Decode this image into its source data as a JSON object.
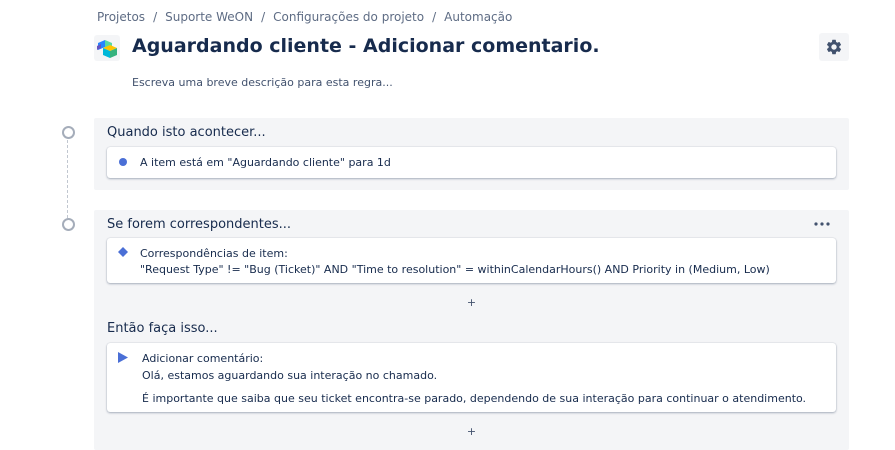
{
  "breadcrumb": {
    "items": [
      "Projetos",
      "Suporte WeON",
      "Configurações do projeto",
      "Automação"
    ],
    "separator": "/"
  },
  "header": {
    "title": "Aguardando cliente - Adicionar comentario.",
    "description_placeholder": "Escreva uma breve descrição para esta regra..."
  },
  "trigger": {
    "title": "Quando isto acontecer...",
    "card_text": "A item está em \"Aguardando cliente\" para 1d"
  },
  "condition": {
    "title": "Se forem correspondentes...",
    "card_line1": "Correspondências de item:",
    "card_line2": "\"Request Type\" != \"Bug (Ticket)\" AND \"Time to resolution\" = withinCalendarHours() AND Priority in (Medium, Low)",
    "add_label": "+"
  },
  "action": {
    "title": "Então faça isso...",
    "card_line1": "Adicionar comentário:",
    "card_line2": "Olá, estamos aguardando sua interação no chamado.",
    "card_line3": "É importante que saiba que seu ticket encontra-se parado, dependendo de sua interação para continuar o atendimento.",
    "add_label": "+"
  },
  "icons": {
    "app_logo": "cube-logo-icon",
    "settings": "gear-icon",
    "more": "more-horizontal-icon",
    "trigger_marker": "dot-icon",
    "condition_marker": "diamond-icon",
    "action_marker": "play-icon"
  },
  "colors": {
    "accent": "#4a6fd6",
    "section_bg": "#f4f5f7",
    "text": "#172b4d",
    "muted": "#5e6c84"
  }
}
